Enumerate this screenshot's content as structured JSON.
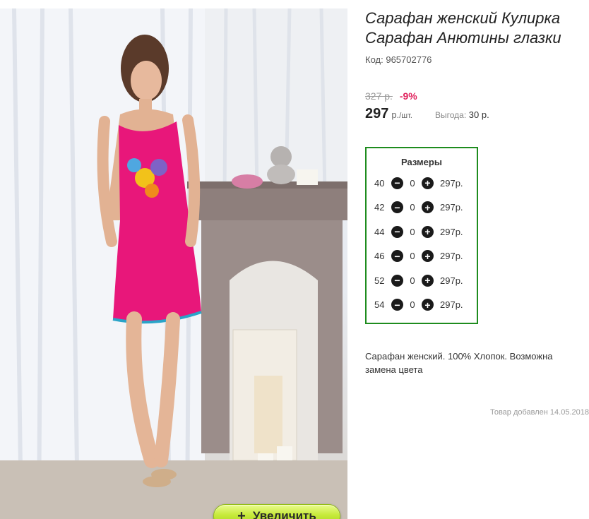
{
  "product": {
    "title": "Сарафан женский Кулирка Сарафан Анютины глазки",
    "code_label": "Код:",
    "code": "965702776"
  },
  "pricing": {
    "old_price": "327 р.",
    "discount": "-9%",
    "price": "297",
    "price_unit": "р.",
    "price_per": "/шт.",
    "saving_label": "Выгода:",
    "saving_value": "30 р."
  },
  "sizes": {
    "title": "Размеры",
    "rows": [
      {
        "size": "40",
        "qty": "0",
        "price": "297р."
      },
      {
        "size": "42",
        "qty": "0",
        "price": "297р."
      },
      {
        "size": "44",
        "qty": "0",
        "price": "297р."
      },
      {
        "size": "46",
        "qty": "0",
        "price": "297р."
      },
      {
        "size": "52",
        "qty": "0",
        "price": "297р."
      },
      {
        "size": "54",
        "qty": "0",
        "price": "297р."
      }
    ]
  },
  "description": "Сарафан женский. 100% Хлопок. Возможна замена цвета",
  "added_text": "Товар добавлен 14.05.2018",
  "zoom_button": {
    "label": "Увеличить",
    "icon": "plus-icon"
  },
  "colors": {
    "accent_green": "#1e8c1e",
    "discount_red": "#e0245e",
    "dress_pink": "#e8177a",
    "button_green": "#c6ea3a"
  }
}
